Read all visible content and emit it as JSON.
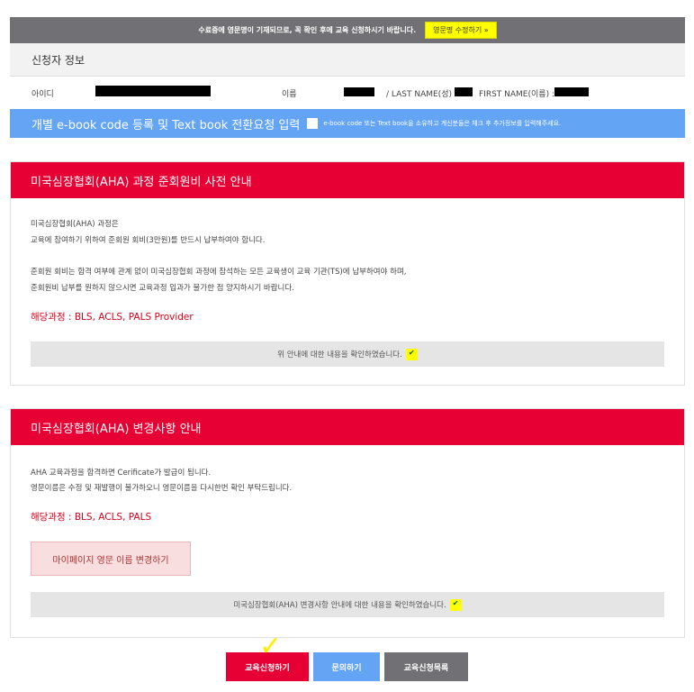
{
  "notice": {
    "text": "수료증에 영문명이 기재되므로, 꼭 확인 후에 교육 신청하시기 바랍니다.",
    "edit_button": "영문명 수정하기 »"
  },
  "applicant": {
    "title": "신청자 정보",
    "id_label": "아이디",
    "name_label": "이름",
    "last_name_label": "/  LAST NAME(성) :",
    "first_name_label": "FIRST NAME(이름) :"
  },
  "ebook": {
    "title": "개별 e-book code 등록 및 Text book 전환요청 입력",
    "note": "e-book code 또는 Text book을 소유하고 계신분들은 체크 후 추가정보를 입력해주세요."
  },
  "section1": {
    "title": "미국심장협회(AHA) 과정 준회원비 사전 안내",
    "line1": "미국심장협회(AHA) 과정은",
    "line2": "교육에 참여하기 위하여 준회원 회비(3만원)를 반드시 납부하여야 합니다.",
    "line3": "준회원 회비는 합격 여부에 관계 없이 미국심장협회 과정에 참석하는 모든 교육생이 교육 기관(TS)에 납부하여야 하며,",
    "line4": "준회원비 납부를 원하지 않으시면 교육과정 입과가 불가한 점 양지하시기 바랍니다.",
    "courses": "해당과정 : BLS, ACLS, PALS Provider",
    "confirm": "위 안내에 대한 내용을 확인하였습니다."
  },
  "section2": {
    "title": "미국심장협회(AHA) 변경사항 안내",
    "line1": "AHA 교육과정을 합격하면 Cerificate가 발급이 됩니다.",
    "line2": "영문이름은 수정 및 재발행이 불가하오니 영문이름을 다시한번 확인 부탁드립니다.",
    "courses": "해당과정 : BLS, ACLS, PALS",
    "mypage_button": "마이페이지 영문 이름 변경하기",
    "confirm": "미국심장협회(AHA) 변경사항 안내에 대한 내용을 확인하였습니다."
  },
  "buttons": {
    "apply": "교육신청하기",
    "inquiry": "문의하기",
    "list": "교육신청목록"
  }
}
